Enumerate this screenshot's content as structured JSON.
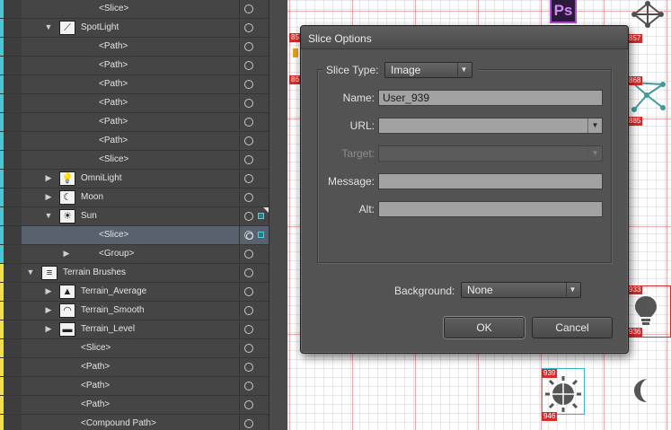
{
  "colors": {
    "cyan_layer": "#4bc6d2",
    "yellow_layer": "#f2e04a",
    "selected_row": "#58626e",
    "slice_red": "#d72a2a",
    "slice_selected": "#33b7c6"
  },
  "layers": [
    {
      "name": "<Slice>",
      "indent": 2,
      "color": "cyan"
    },
    {
      "name": "SpotLight",
      "indent": 1,
      "color": "cyan",
      "expanded": true,
      "thumb": "spotlight-icon"
    },
    {
      "name": "<Path>",
      "indent": 2,
      "color": "cyan"
    },
    {
      "name": "<Path>",
      "indent": 2,
      "color": "cyan"
    },
    {
      "name": "<Path>",
      "indent": 2,
      "color": "cyan"
    },
    {
      "name": "<Path>",
      "indent": 2,
      "color": "cyan"
    },
    {
      "name": "<Path>",
      "indent": 2,
      "color": "cyan"
    },
    {
      "name": "<Path>",
      "indent": 2,
      "color": "cyan"
    },
    {
      "name": "<Slice>",
      "indent": 2,
      "color": "cyan"
    },
    {
      "name": "OmniLight",
      "indent": 1,
      "color": "cyan",
      "expanded": false,
      "thumb": "bulb-icon"
    },
    {
      "name": "Moon",
      "indent": 1,
      "color": "cyan",
      "expanded": false,
      "thumb": "moon-icon"
    },
    {
      "name": "Sun",
      "indent": 1,
      "color": "cyan",
      "expanded": true,
      "thumb": "sun-icon",
      "marker": true
    },
    {
      "name": "<Slice>",
      "indent": 2,
      "color": "cyan",
      "selected": true
    },
    {
      "name": "<Group>",
      "indent": 2,
      "color": "cyan",
      "expanded": false,
      "group": true
    },
    {
      "name": "Terrain Brushes",
      "indent": 0,
      "color": "yellow",
      "expanded": true,
      "thumb": "brushes-icon"
    },
    {
      "name": "Terrain_Average",
      "indent": 1,
      "color": "yellow",
      "expanded": false,
      "thumb": "terrain-average-icon"
    },
    {
      "name": "Terrain_Smooth",
      "indent": 1,
      "color": "yellow",
      "expanded": false,
      "thumb": "terrain-smooth-icon"
    },
    {
      "name": "Terrain_Level",
      "indent": 1,
      "color": "yellow",
      "expanded": false,
      "thumb": "terrain-level-icon"
    },
    {
      "name": "<Slice>",
      "indent": 1,
      "color": "yellow"
    },
    {
      "name": "<Path>",
      "indent": 1,
      "color": "yellow"
    },
    {
      "name": "<Path>",
      "indent": 1,
      "color": "yellow"
    },
    {
      "name": "<Path>",
      "indent": 1,
      "color": "yellow"
    },
    {
      "name": "<Compound Path>",
      "indent": 1,
      "color": "yellow"
    }
  ],
  "canvas": {
    "ps_logo": "Ps",
    "slice_numbers": [
      "857",
      "868",
      "885",
      "933",
      "936",
      "939",
      "946"
    ],
    "partial_numbers": [
      "85",
      "86"
    ]
  },
  "dialog": {
    "title": "Slice Options",
    "slice_type_label": "Slice Type:",
    "slice_type_value": "Image",
    "name_label": "Name:",
    "name_value": "User_939",
    "url_label": "URL:",
    "url_value": "",
    "target_label": "Target:",
    "target_value": "",
    "message_label": "Message:",
    "message_value": "",
    "alt_label": "Alt:",
    "alt_value": "",
    "background_label": "Background:",
    "background_value": "None",
    "ok_label": "OK",
    "cancel_label": "Cancel"
  }
}
